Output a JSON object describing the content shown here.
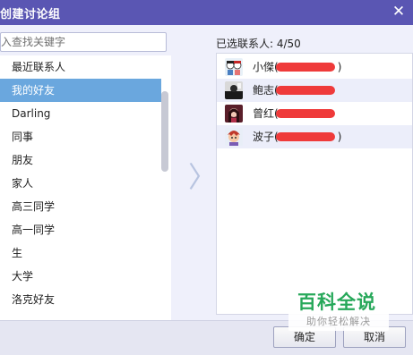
{
  "window": {
    "title": "创建讨论组",
    "close_glyph": "✕"
  },
  "search": {
    "placeholder": "入查找关键字"
  },
  "groups": [
    "最近联系人",
    "我的好友",
    "Darling",
    "同事",
    "朋友",
    "家人",
    "高三同学",
    "高一同学",
    "生",
    "大学",
    "洛克好友"
  ],
  "selected_group_index": 1,
  "move_arrow_glyph": "〉",
  "selected": {
    "label": "已选联系人: 4/50",
    "contacts": [
      {
        "name": "小傑(",
        "tail": ")"
      },
      {
        "name": "鲍志(",
        "tail": ""
      },
      {
        "name": "曾红(",
        "tail": ""
      },
      {
        "name": "波子(",
        "tail": ")"
      }
    ]
  },
  "buttons": {
    "ok": "确定",
    "cancel": "取消"
  },
  "watermark": {
    "title": "百科全说",
    "subtitle": "助你轻松解决"
  },
  "colors": {
    "titlebar": "#5a56b3",
    "selected_row": "#6aa7de",
    "redaction": "#ef3a3a",
    "watermark": "#27a85a"
  }
}
